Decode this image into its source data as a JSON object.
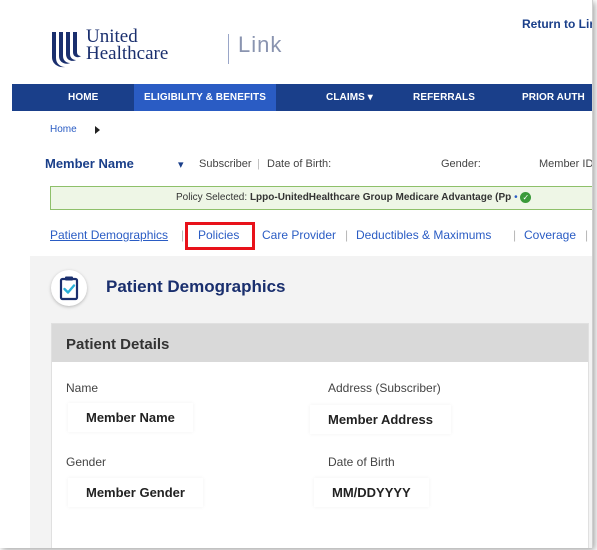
{
  "header": {
    "return_link": "Return to Lir",
    "logo_line1": "United",
    "logo_line2": "Healthcare",
    "logo_product": "Link"
  },
  "nav": {
    "items": [
      {
        "label": "HOME"
      },
      {
        "label": "ELIGIBILITY & BENEFITS"
      },
      {
        "label": "CLAIMS ▾"
      },
      {
        "label": "REFERRALS"
      },
      {
        "label": "PRIOR AUTH"
      }
    ],
    "active_index": 1
  },
  "breadcrumb": {
    "home": "Home"
  },
  "member": {
    "name": "Member Name",
    "subscriber": "Subscriber",
    "dob_label": "Date of Birth:",
    "gender_label": "Gender:",
    "member_id_label": "Member ID"
  },
  "policy": {
    "prefix": "Policy Selected:",
    "name": "Lppo-UnitedHealthcare Group Medicare Advantage (Pp"
  },
  "subtabs": {
    "items": [
      {
        "label": "Patient Demographics"
      },
      {
        "label": "Policies"
      },
      {
        "label": "Care Provider"
      },
      {
        "label": "Deductibles & Maximums"
      },
      {
        "label": "Coverage"
      }
    ]
  },
  "section": {
    "title": "Patient Demographics",
    "card_title": "Patient Details",
    "fields": {
      "name_label": "Name",
      "name_value": "Member Name",
      "address_label": "Address (Subscriber)",
      "address_value": "Member Address",
      "gender_label": "Gender",
      "gender_value": "Member Gender",
      "dob_label": "Date of Birth",
      "dob_value": "MM/DDYYYY"
    }
  },
  "colors": {
    "nav_bg": "#1a3f8a",
    "nav_active": "#2a5cc4",
    "link": "#2a5cc4",
    "highlight_box": "#e8121a",
    "policy_bg": "#eef6e6"
  },
  "icons": {
    "logo": "unitedhealthcare-logo-icon",
    "breadcrumb_arrow": "caret-right-icon",
    "member_dropdown": "chevron-down-icon",
    "policy_status": "check-circle-icon",
    "section": "clipboard-check-icon"
  }
}
